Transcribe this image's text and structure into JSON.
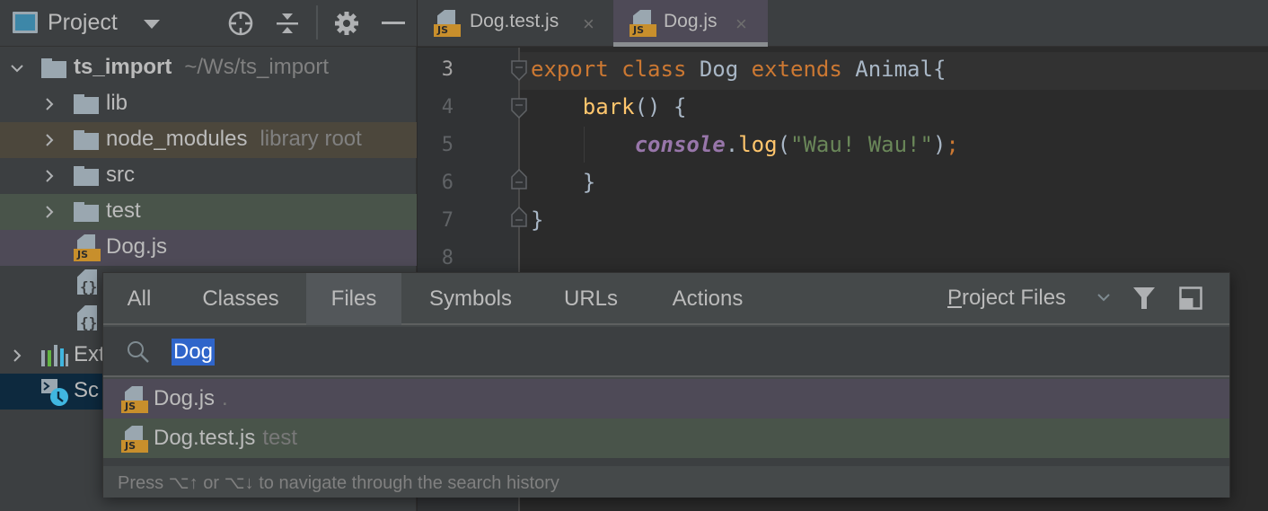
{
  "project_panel": {
    "title": "Project",
    "toolbar_icons": [
      "locate-icon",
      "collapse-all-icon",
      "gear-icon",
      "hide-icon"
    ],
    "tree": [
      {
        "label": "ts_import",
        "hint": "~/Ws/ts_import",
        "type": "folder",
        "expanded": true,
        "bold": true
      },
      {
        "label": "lib",
        "hint": "",
        "type": "folder",
        "expanded": false
      },
      {
        "label": "node_modules",
        "hint": "library root",
        "type": "folder",
        "expanded": false,
        "highlight": "#4c473c"
      },
      {
        "label": "src",
        "hint": "",
        "type": "folder",
        "expanded": false
      },
      {
        "label": "test",
        "hint": "",
        "type": "folder",
        "expanded": false,
        "highlight": "#49544a"
      },
      {
        "label": "Dog.js",
        "hint": "",
        "type": "js-file",
        "highlight": "#4e4a57"
      },
      {
        "label": "",
        "hint": "",
        "type": "json-file"
      },
      {
        "label": "",
        "hint": "",
        "type": "json-file"
      },
      {
        "label": "Ext",
        "hint": "",
        "type": "external-libraries",
        "expanded": false
      },
      {
        "label": "Sc",
        "hint": "",
        "type": "scratches",
        "highlight": "#0d293e"
      }
    ]
  },
  "tabs": [
    {
      "label": "Dog.test.js",
      "active": false,
      "close": "×"
    },
    {
      "label": "Dog.js",
      "active": true,
      "close": "×"
    }
  ],
  "editor": {
    "line_numbers": [
      "3",
      "4",
      "5",
      "6",
      "7",
      "8"
    ],
    "current_line": "3",
    "lines": [
      [
        {
          "t": "export",
          "c": "kw"
        },
        {
          "t": " "
        },
        {
          "t": "class",
          "c": "kw"
        },
        {
          "t": " Dog "
        },
        {
          "t": "extends",
          "c": "kw"
        },
        {
          "t": " Animal{"
        }
      ],
      [
        {
          "t": "    "
        },
        {
          "t": "bark",
          "c": "fn"
        },
        {
          "t": "() {"
        }
      ],
      [
        {
          "t": "        "
        },
        {
          "t": "console",
          "c": "obj"
        },
        {
          "t": "."
        },
        {
          "t": "log",
          "c": "fn"
        },
        {
          "t": "("
        },
        {
          "t": "\"Wau! Wau!\"",
          "c": "str"
        },
        {
          "t": ")"
        },
        {
          "t": ";",
          "c": "kw"
        }
      ],
      [
        {
          "t": "    }"
        }
      ],
      [
        {
          "t": "}"
        }
      ],
      [
        {
          "t": ""
        }
      ]
    ]
  },
  "search_everywhere": {
    "tabs": [
      "All",
      "Classes",
      "Files",
      "Symbols",
      "URLs",
      "Actions"
    ],
    "selected_tab": "Files",
    "scope": {
      "mnemonic": "P",
      "rest": "roject Files"
    },
    "query": "Dog",
    "results": [
      {
        "name": "Dog.js",
        "location": ".",
        "highlight": "#4e4a57"
      },
      {
        "name": "Dog.test.js",
        "location": "test",
        "highlight": "#49544a"
      }
    ],
    "hint": "Press ⌥↑ or ⌥↓ to navigate through the search history"
  },
  "colors": {
    "js_badge": "#c88f2c",
    "selection": "#2f65ca",
    "keyword": "#cc7832",
    "function": "#ffc66d",
    "string": "#6a8759",
    "global_object": "#9876aa"
  }
}
